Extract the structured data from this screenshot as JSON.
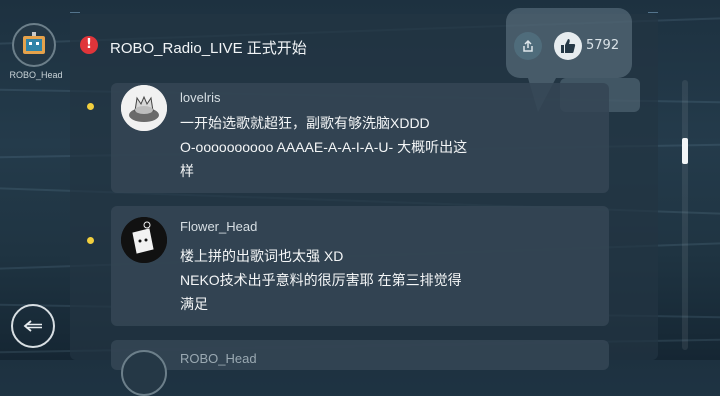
{
  "header": {
    "title": "ROBO_Radio_LIVE 正式开始",
    "like_count": "5792"
  },
  "current_user": {
    "name": "ROBO_Head"
  },
  "comments": [
    {
      "username": "lovelris",
      "text": "一开始选歌就超狂，副歌有够洗脑XDDD\nO-oooooooooo AAAAE-A-A-I-A-U- 大概听出这\n样"
    },
    {
      "username": "Flower_Head",
      "text": "楼上拼的出歌词也太强 XD\nNEKO技术出乎意料的很厉害耶 在第三排觉得\n满足"
    },
    {
      "username": "ROBO_Head",
      "text": ""
    }
  ],
  "icons": {
    "alert": "alert-icon",
    "share": "share-icon",
    "like": "thumbs-up-icon",
    "back": "back-arrow-icon"
  },
  "colors": {
    "alert": "#e0353a",
    "bullet": "#f2cf3e",
    "panel": "#223442"
  }
}
